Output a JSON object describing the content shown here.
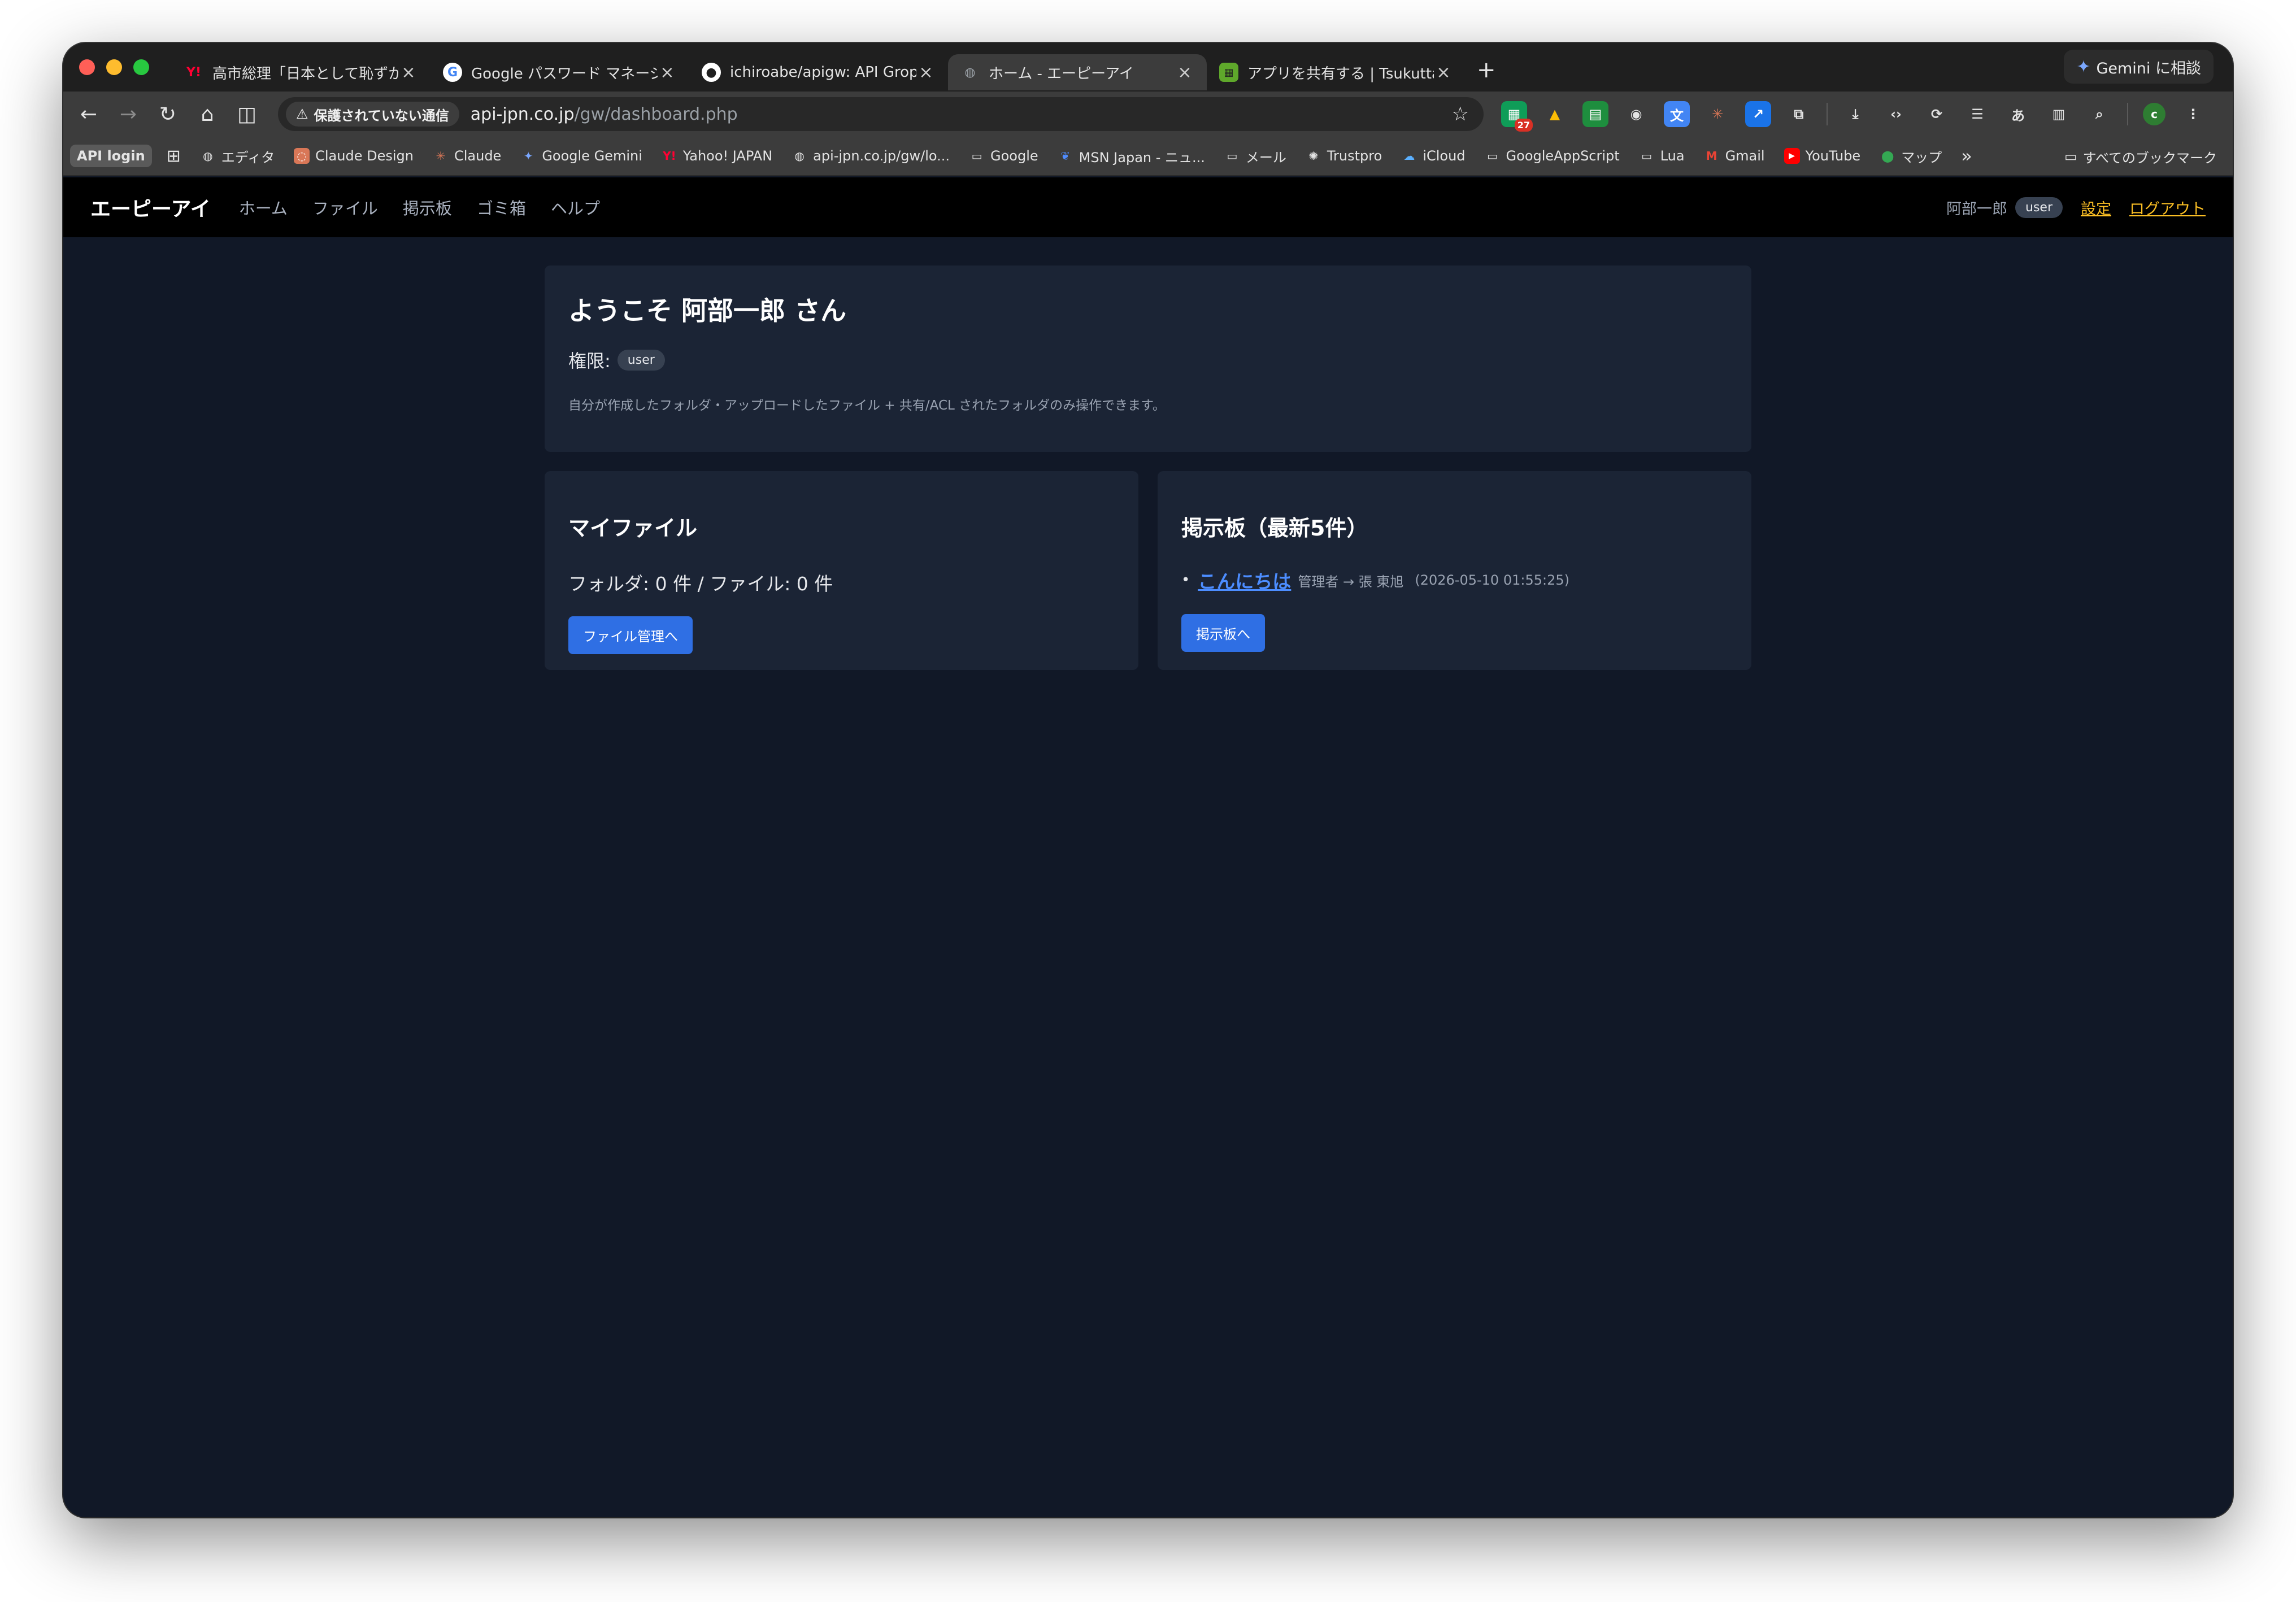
{
  "browser": {
    "tabs": [
      {
        "title": "高市総理「日本として恥ずかしい",
        "favicon_color": "#ff0033",
        "favicon_glyph": "Y!"
      },
      {
        "title": "Google パスワード マネージャー",
        "favicon_color": "#ffffff",
        "favicon_glyph": "G"
      },
      {
        "title": "ichiroabe/apigw: API Gropu W",
        "favicon_color": "#ffffff",
        "favicon_glyph": "●"
      },
      {
        "title": "ホーム - エーピーアイ",
        "favicon_color": "#9aa0a6",
        "favicon_glyph": "◍"
      },
      {
        "title": "アプリを共有する | Tsukutta",
        "favicon_color": "#5fa82b",
        "favicon_glyph": "▦"
      }
    ],
    "gemini_label": "Gemini に相談",
    "omnibox": {
      "security_label": "保護されていない通信",
      "url_host": "api-jpn.co.jp",
      "url_path": "/gw/dashboard.php"
    },
    "extension_badge": "27",
    "profile_initial": "c",
    "bookmarks": [
      {
        "label": "API login"
      },
      {
        "label": "エディタ"
      },
      {
        "label": "Claude Design"
      },
      {
        "label": "Claude"
      },
      {
        "label": "Google Gemini"
      },
      {
        "label": "Yahoo! JAPAN"
      },
      {
        "label": "api-jpn.co.jp/gw/lo..."
      },
      {
        "label": "Google"
      },
      {
        "label": "MSN Japan - ニュ..."
      },
      {
        "label": "メール"
      },
      {
        "label": "Trustpro"
      },
      {
        "label": "iCloud"
      },
      {
        "label": "GoogleAppScript"
      },
      {
        "label": "Lua"
      },
      {
        "label": "Gmail"
      },
      {
        "label": "YouTube"
      },
      {
        "label": "マップ"
      }
    ],
    "overflow": "»",
    "all_bookmarks": "すべてのブックマーク"
  },
  "app": {
    "brand": "エーピーアイ",
    "nav": [
      "ホーム",
      "ファイル",
      "掲示板",
      "ゴミ箱",
      "ヘルプ"
    ],
    "user_name": "阿部一郎",
    "user_role": "user",
    "settings": "設定",
    "logout": "ログアウト"
  },
  "welcome": {
    "title": "ようこそ 阿部一郎 さん",
    "role_label": "権限:",
    "role_value": "user",
    "note": "自分が作成したフォルダ・アップロードしたファイル + 共有/ACL されたフォルダのみ操作できます。"
  },
  "myfiles": {
    "title": "マイファイル",
    "counts": "フォルダ: 0 件 / ファイル: 0 件",
    "button": "ファイル管理へ"
  },
  "board": {
    "title": "掲示板（最新5件）",
    "posts": [
      {
        "title": "こんにちは",
        "meta": "管理者 → 張 東旭",
        "time": "(2026-05-10 01:55:25)"
      }
    ],
    "button": "掲示板へ"
  },
  "colors": {
    "page_bg": "#111827",
    "card_bg": "#1b2435",
    "accent_button": "#2f6fe4",
    "link_orange": "#fbbf24",
    "post_link": "#4c8dff"
  }
}
